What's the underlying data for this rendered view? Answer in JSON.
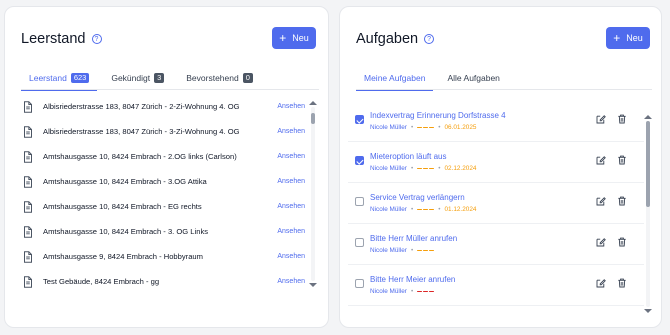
{
  "left": {
    "title": "Leerstand",
    "new_label": "Neu",
    "tabs": [
      {
        "label": "Leerstand",
        "count": "623",
        "active": true
      },
      {
        "label": "Gekündigt",
        "count": "3",
        "active": false
      },
      {
        "label": "Bevorstehend",
        "count": "0",
        "active": false
      }
    ],
    "items": [
      {
        "address": "Albisriederstrasse 183, 8047 Zürich - 2-Zi-Wohnung 4. OG",
        "action": "Ansehen"
      },
      {
        "address": "Albisriederstrasse 183, 8047 Zürich - 3-Zi-Wohnung 4. OG",
        "action": "Ansehen"
      },
      {
        "address": "Amtshausgasse 10, 8424 Embrach - 2.OG links (Carlson)",
        "action": "Ansehen"
      },
      {
        "address": "Amtshausgasse 10, 8424 Embrach - 3.OG Attika",
        "action": "Ansehen"
      },
      {
        "address": "Amtshausgasse 10, 8424 Embrach - EG rechts",
        "action": "Ansehen"
      },
      {
        "address": "Amtshausgasse 10, 8424 Embrach - 3. OG Links",
        "action": "Ansehen"
      },
      {
        "address": "Amtshausgasse 9, 8424 Embrach - Hobbyraum",
        "action": "Ansehen"
      },
      {
        "address": "Test Gebäude, 8424 Embrach - gg",
        "action": "Ansehen"
      }
    ]
  },
  "right": {
    "title": "Aufgaben",
    "new_label": "Neu",
    "tabs": [
      {
        "label": "Meine Aufgaben",
        "active": true
      },
      {
        "label": "Alle Aufgaben",
        "active": false
      }
    ],
    "tasks": [
      {
        "title": "Indexvertrag Erinnerung Dorfstrasse 4",
        "user": "Nicole Müller",
        "date": "06.01.2025",
        "checked": true,
        "priority_color": "#f59e0b"
      },
      {
        "title": "Mieteroption läuft aus",
        "user": "Nicole Müller",
        "date": "02.12.2024",
        "checked": true,
        "priority_color": "#f59e0b"
      },
      {
        "title": "Service Vertrag verlängern",
        "user": "Nicole Müller",
        "date": "01.12.2024",
        "checked": false,
        "priority_color": "#f59e0b"
      },
      {
        "title": "Bitte Herr Müller anrufen",
        "user": "Nicole Müller",
        "date": "",
        "checked": false,
        "priority_color": "#f59e0b"
      },
      {
        "title": "Bitte Herr Meier anrufen",
        "user": "Nicole Müller",
        "date": "",
        "checked": false,
        "priority_color": "#dc2626"
      }
    ]
  },
  "colors": {
    "accent": "#4f6bed",
    "date": "#f59e0b",
    "priority_high": "#dc2626"
  }
}
